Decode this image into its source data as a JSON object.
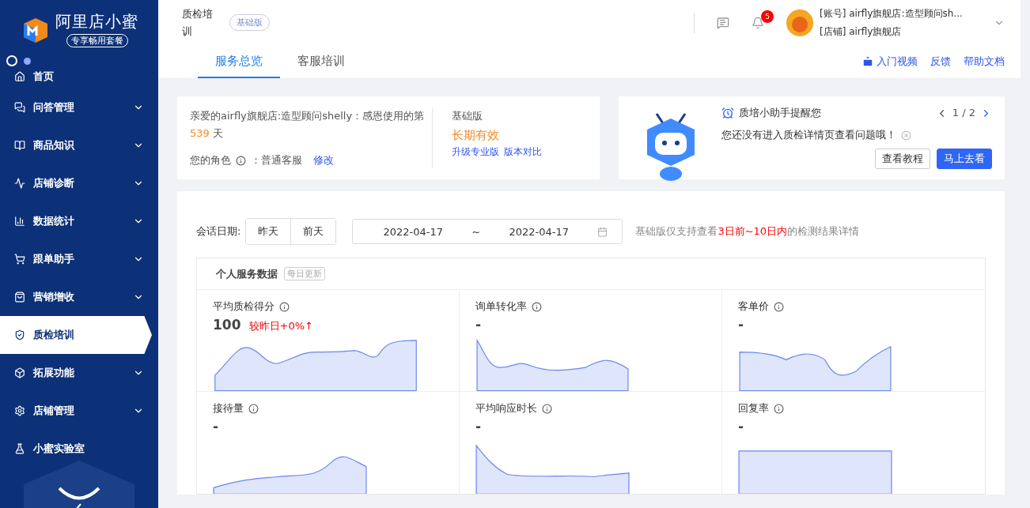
{
  "sidebar": {
    "brand": "阿里店小蜜",
    "badge": "专享畅用套餐",
    "items": [
      {
        "label": "首页",
        "selected": false,
        "expandable": false
      },
      {
        "label": "问答管理",
        "selected": false,
        "expandable": true
      },
      {
        "label": "商品知识",
        "selected": false,
        "expandable": true
      },
      {
        "label": "店铺诊断",
        "selected": false,
        "expandable": true
      },
      {
        "label": "数据统计",
        "selected": false,
        "expandable": true
      },
      {
        "label": "跟单助手",
        "selected": false,
        "expandable": true
      },
      {
        "label": "营销增收",
        "selected": false,
        "expandable": true
      },
      {
        "label": "质检培训",
        "selected": true,
        "expandable": false
      },
      {
        "label": "拓展功能",
        "selected": false,
        "expandable": true
      },
      {
        "label": "店铺管理",
        "selected": false,
        "expandable": true
      },
      {
        "label": "小蜜实验室",
        "selected": false,
        "expandable": false
      }
    ]
  },
  "header": {
    "title": "质检培训",
    "edition": "基础版",
    "notifications": "5",
    "account": "[账号] airfly旗舰店:造型顾问sh...",
    "shop": "[店铺] airfly旗舰店"
  },
  "tabs": [
    {
      "label": "服务总览",
      "selected": true
    },
    {
      "label": "客服培训",
      "selected": false
    }
  ],
  "links": [
    "入门视频",
    "反馈",
    "帮助文档"
  ],
  "welcome": {
    "greeting": "亲爱的airfly旗舰店:造型顾问shelly：感恩使用的第",
    "days": "539",
    "unit": "天",
    "role_label": "您的角色",
    "role": "：普通客服",
    "edit": "修改",
    "plan": "基础版",
    "validity": "长期有效",
    "upgrade": "升级专业版",
    "compare": "版本对比"
  },
  "reminder": {
    "title": "质培小助手提醒您",
    "message": "您还没有进入质检详情页查看问题哦！",
    "pager": "1 / 2",
    "buttons": [
      {
        "label": "查看教程",
        "primary": false
      },
      {
        "label": "马上去看",
        "primary": true
      }
    ]
  },
  "filters": {
    "label": "会话日期:",
    "quick": [
      {
        "label": "昨天",
        "selected": false
      },
      {
        "label": "前天",
        "selected": false
      }
    ],
    "start": "2022-04-17",
    "separator": "~",
    "end": "2022-04-17",
    "note": "基础版仅支持查看**3日前~10日内**的检测结果详情"
  },
  "stats": {
    "title": "个人服务数据",
    "badge": "每日更新",
    "metrics": [
      {
        "label": "平均质检得分",
        "value": "100",
        "change": "较昨日+0%↑"
      },
      {
        "label": "询单转化率",
        "value": "-"
      },
      {
        "label": "客单价",
        "value": "-"
      },
      {
        "label": "接待量",
        "value": "-"
      },
      {
        "label": "平均响应时长",
        "value": "-"
      },
      {
        "label": "回复率",
        "value": "-"
      }
    ]
  }
}
